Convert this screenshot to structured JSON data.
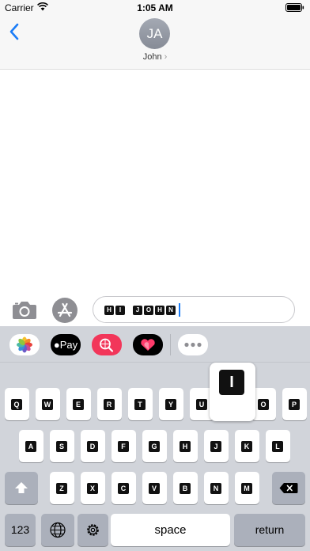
{
  "status_bar": {
    "carrier": "Carrier",
    "time": "1:05 AM"
  },
  "header": {
    "avatar_initials": "JA",
    "contact_name": "John",
    "chevron": "›"
  },
  "composer": {
    "message_tiles": [
      [
        "H",
        "I"
      ],
      [
        "J",
        "O",
        "H",
        "N"
      ]
    ],
    "accent_color": "#1a7cf7"
  },
  "app_tray": {
    "apps": [
      "photos-app",
      "apple-pay-app",
      "image-search-app",
      "hearts-sticker-app",
      "more-apps"
    ],
    "pay_label": "Pay"
  },
  "keyboard": {
    "row1": [
      "Q",
      "W",
      "E",
      "R",
      "T",
      "Y",
      "U",
      "I",
      "O",
      "P"
    ],
    "row2": [
      "A",
      "S",
      "D",
      "F",
      "G",
      "H",
      "J",
      "K",
      "L"
    ],
    "row3": [
      "Z",
      "X",
      "C",
      "V",
      "B",
      "N",
      "M"
    ],
    "numbers_label": "123",
    "space_label": "space",
    "return_label": "return",
    "popup_key": "I"
  }
}
